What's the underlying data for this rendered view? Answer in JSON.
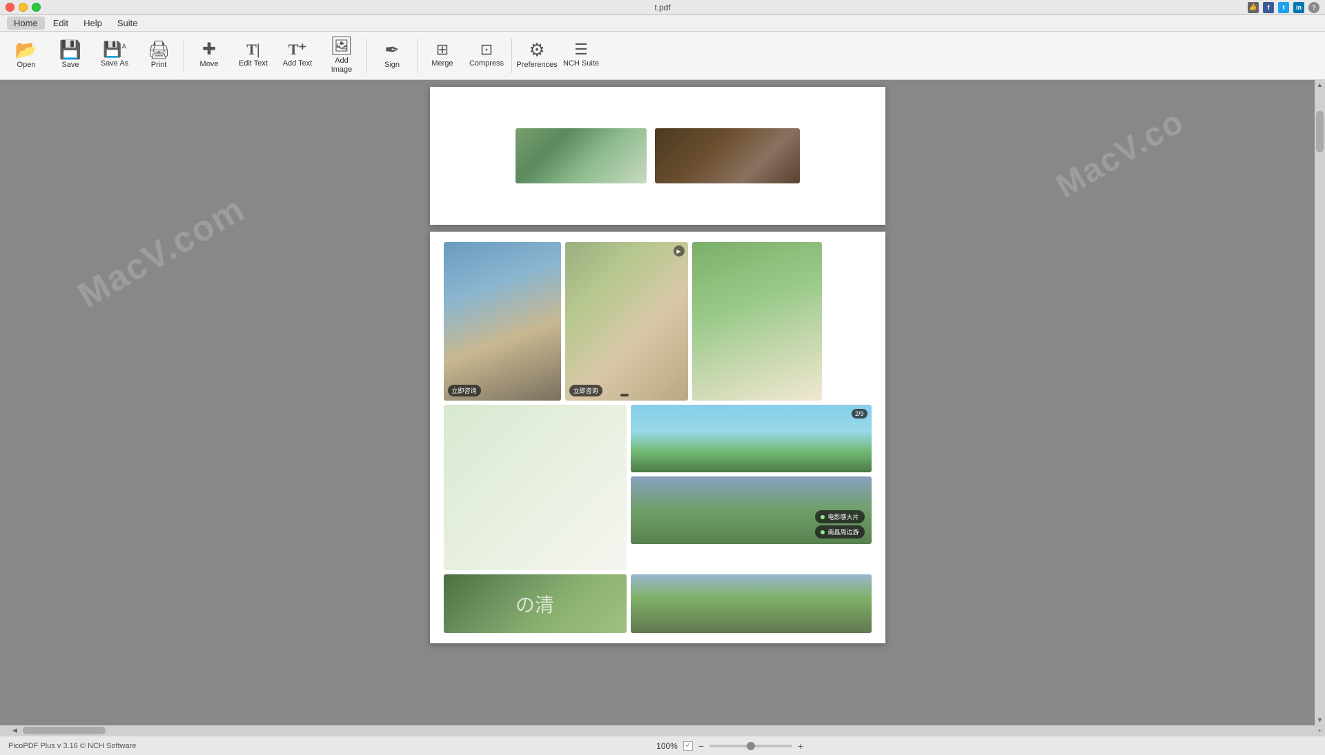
{
  "titleBar": {
    "title": "t.pdf",
    "trafficLights": [
      "close",
      "minimize",
      "maximize"
    ]
  },
  "menuBar": {
    "items": [
      "Home",
      "Edit",
      "Help",
      "Suite"
    ]
  },
  "toolbar": {
    "buttons": [
      {
        "id": "open",
        "icon": "📂",
        "label": "Open"
      },
      {
        "id": "save",
        "icon": "💾",
        "label": "Save"
      },
      {
        "id": "save-as",
        "icon": "💾",
        "label": "Save As"
      },
      {
        "id": "print",
        "icon": "🖨",
        "label": "Print"
      },
      {
        "id": "move",
        "icon": "✥",
        "label": "Move"
      },
      {
        "id": "edit-text",
        "icon": "T|",
        "label": "Edit Text"
      },
      {
        "id": "add-text",
        "icon": "T+",
        "label": "Add Text"
      },
      {
        "id": "add-image",
        "icon": "🖼",
        "label": "Add Image"
      },
      {
        "id": "sign",
        "icon": "✍",
        "label": "Sign"
      },
      {
        "id": "merge",
        "icon": "⊞",
        "label": "Merge"
      },
      {
        "id": "compress",
        "icon": "⊡",
        "label": "Compress"
      },
      {
        "id": "preferences",
        "icon": "⚙",
        "label": "Preferences"
      },
      {
        "id": "nch-suite",
        "icon": "☰",
        "label": "NCH Suite"
      }
    ]
  },
  "statusBar": {
    "appInfo": "PicoPDF Plus v 3.16 © NCH Software",
    "zoomLevel": "100%",
    "zoomPlus": "+",
    "zoomMinus": "−"
  },
  "watermarks": [
    "MacV.com",
    "MacV.co"
  ],
  "photos": {
    "topRow": [
      {
        "id": "outdoor-couple",
        "type": "outdoor"
      },
      {
        "id": "dark-couple",
        "type": "dark"
      }
    ],
    "gridPhotos": [
      {
        "id": "mountain-couple",
        "badge": "立即咨询",
        "badge2": "立即咨询"
      },
      {
        "id": "sitting-couple",
        "badge": "立即咨询"
      },
      {
        "id": "couple-flowers",
        "badge": ""
      },
      {
        "id": "couple-white-dress"
      },
      {
        "id": "lake-woman",
        "number": "2/9"
      },
      {
        "id": "text-overlay",
        "text": "の清"
      },
      {
        "id": "cattle-field-1",
        "chat1": "电影感大片",
        "chat2": "南昌周边游"
      },
      {
        "id": "cattle-field-2"
      }
    ]
  },
  "socialIcons": {
    "thumbs": "👍",
    "fb": "f",
    "tw": "t",
    "li": "in",
    "help": "?"
  }
}
